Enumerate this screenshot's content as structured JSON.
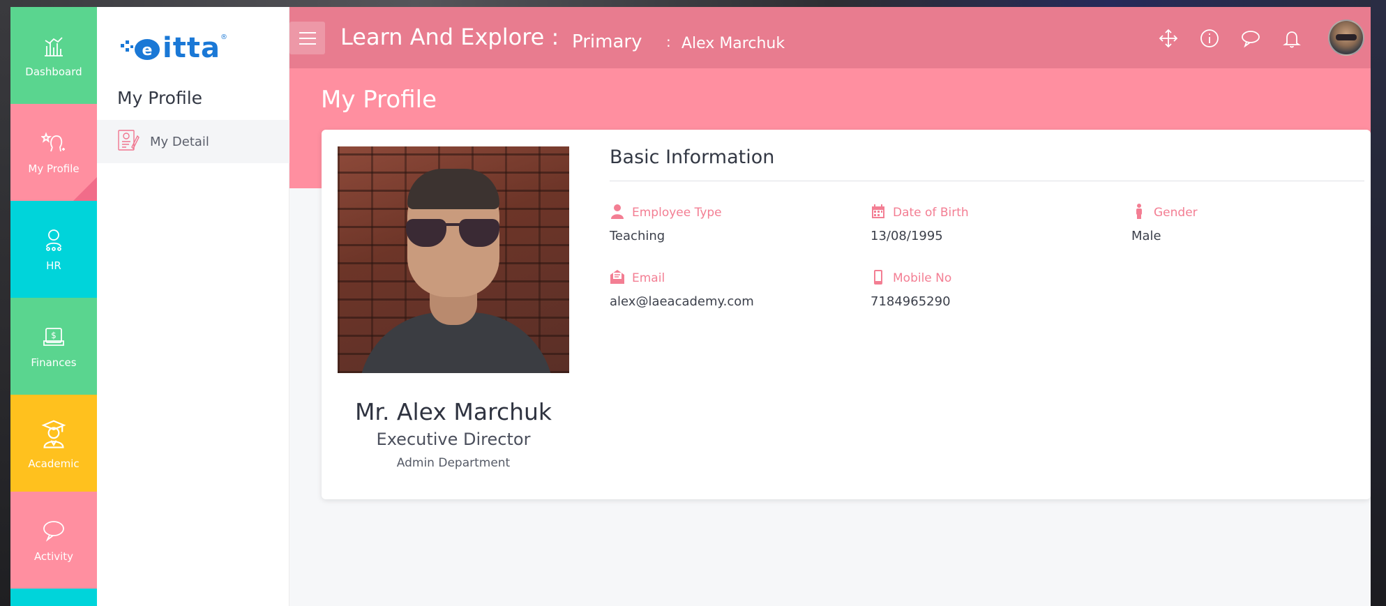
{
  "rail": {
    "items": [
      {
        "label": "Dashboard",
        "icon": "bar-chart-icon",
        "color": "#5ad58f"
      },
      {
        "label": "My Profile",
        "icon": "profile-star-icon",
        "color": "#ff8fa0",
        "active": true
      },
      {
        "label": "HR",
        "icon": "person-network-icon",
        "color": "#00d4da"
      },
      {
        "label": "Finances",
        "icon": "money-box-icon",
        "color": "#5ad58f"
      },
      {
        "label": "Academic",
        "icon": "graduate-icon",
        "color": "#ffc11e"
      },
      {
        "label": "Activity",
        "icon": "speech-bubble-icon",
        "color": "#ff8fa0"
      }
    ]
  },
  "brand": {
    "name": "itta",
    "registered": "®"
  },
  "subnav": {
    "title": "My Profile",
    "items": [
      {
        "label": "My Detail",
        "icon": "detail-document-icon"
      }
    ]
  },
  "topbar": {
    "title": "Learn And Explore :",
    "section": "Primary",
    "separator": ":",
    "user": "Alex Marchuk",
    "icons": [
      "move-arrows-icon",
      "info-icon",
      "chat-icon",
      "bell-icon"
    ],
    "color": "#e87c8f"
  },
  "page": {
    "title": "My Profile",
    "banner_color": "#ff8fa0"
  },
  "profile": {
    "name": "Mr. Alex Marchuk",
    "role": "Executive Director",
    "department": "Admin Department"
  },
  "basic_info": {
    "title": "Basic Information",
    "fields": [
      {
        "label": "Employee Type",
        "value": "Teaching",
        "icon": "employee-icon"
      },
      {
        "label": "Date of Birth",
        "value": "13/08/1995",
        "icon": "calendar-icon"
      },
      {
        "label": "Gender",
        "value": "Male",
        "icon": "male-icon"
      },
      {
        "label": "Email",
        "value": "alex@laeacademy.com",
        "icon": "email-icon"
      },
      {
        "label": "Mobile No",
        "value": "7184965290",
        "icon": "mobile-icon"
      }
    ],
    "accent": "#f37e93"
  }
}
